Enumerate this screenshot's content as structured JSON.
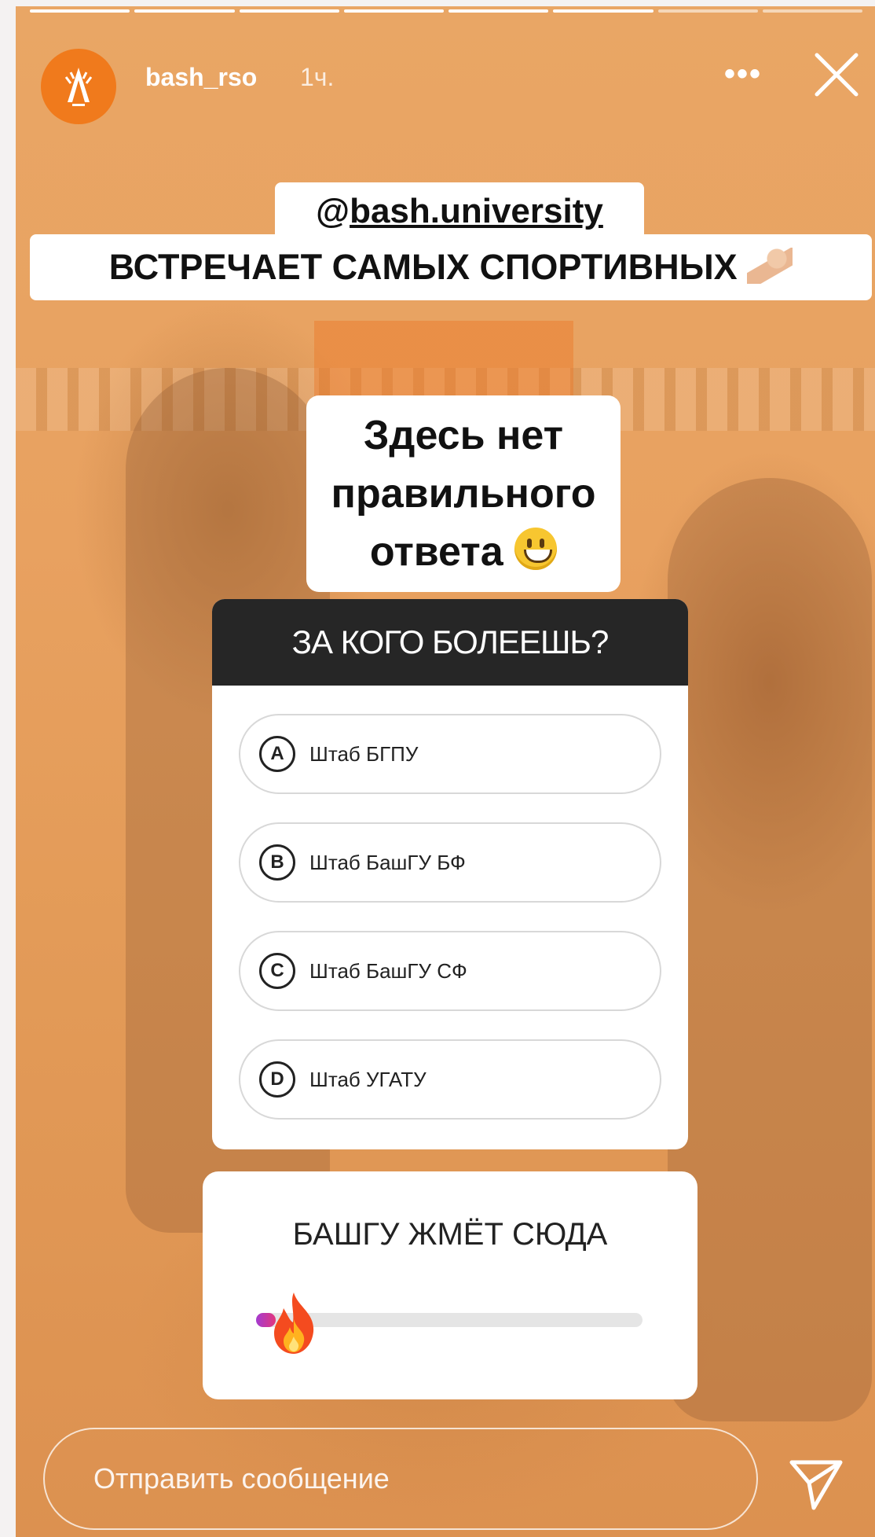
{
  "story": {
    "username": "bash_rso",
    "time": "1ч.",
    "more_label": "•••",
    "progress": {
      "total": 8,
      "completed": 6
    }
  },
  "stickers": {
    "mention_prefix": "@",
    "mention": "bash.university",
    "headline": "ВСТРЕЧАЕТ САМЫХ СПОРТИВНЫХ",
    "note_lines": [
      "Здесь нет",
      "правильного",
      "ответа"
    ]
  },
  "quiz": {
    "question": "ЗА КОГО БОЛЕЕШЬ?",
    "options": [
      {
        "letter": "A",
        "text": "Штаб БГПУ"
      },
      {
        "letter": "B",
        "text": "Штаб БашГУ БФ"
      },
      {
        "letter": "C",
        "text": "Штаб БашГУ СФ"
      },
      {
        "letter": "D",
        "text": "Штаб УГАТУ"
      }
    ]
  },
  "slider": {
    "question": "БАШГУ ЖМЁТ СЮДА",
    "value": 0.05,
    "emoji": "fire"
  },
  "footer": {
    "message_placeholder": "Отправить сообщение",
    "send_icon": "paper-plane-icon"
  },
  "colors": {
    "overlay": "#e8a160",
    "quiz_header": "#262626",
    "avatar": "#f07a1c"
  }
}
